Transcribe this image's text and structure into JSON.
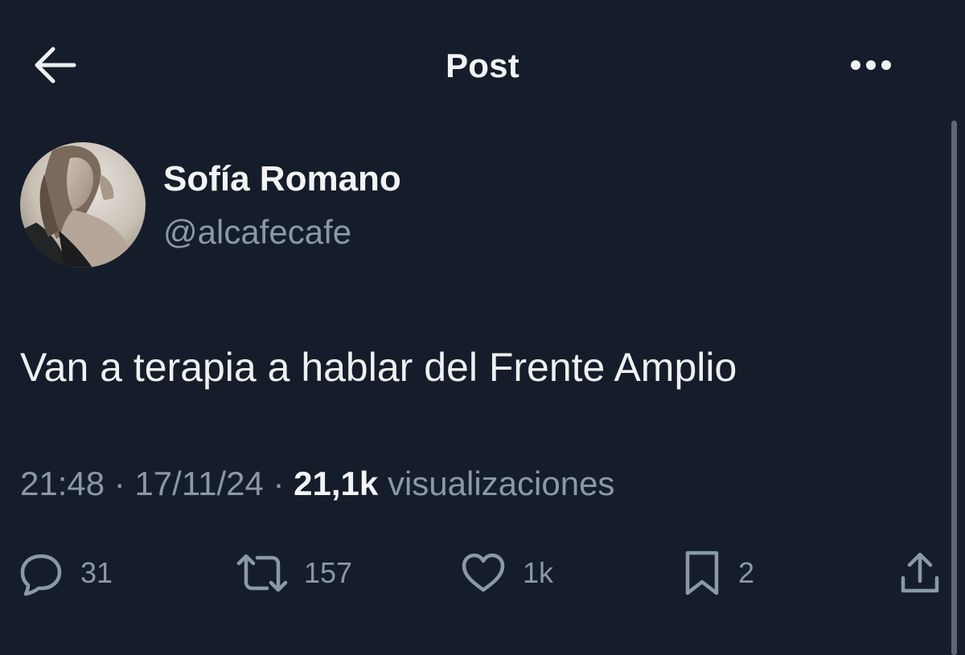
{
  "header": {
    "title": "Post",
    "back_icon": "arrow-left-icon",
    "more_icon": "more-horizontal-icon"
  },
  "author": {
    "name": "Sofía Romano",
    "handle": "@alcafecafe"
  },
  "post": {
    "text": "Van a terapia a hablar del Frente Amplio",
    "time": "21:48",
    "date": "17/11/24",
    "separator": "·",
    "views_count": "21,1k",
    "views_label": "visualizaciones"
  },
  "actions": {
    "replies": "31",
    "reposts": "157",
    "likes": "1k",
    "bookmarks": "2"
  },
  "colors": {
    "background": "#151d2a",
    "primary_text": "#e7e9ea",
    "secondary_text": "#8b98a5"
  }
}
